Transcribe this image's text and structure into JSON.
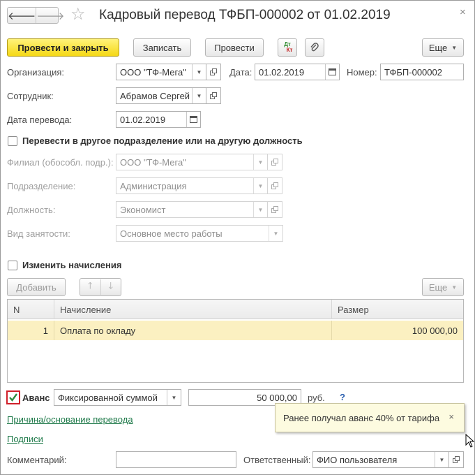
{
  "window": {
    "title": "Кадровый перевод ТФБП-000002 от 01.02.2019",
    "nav_back": "🡐",
    "nav_forward": "🡒",
    "favorite_glyph": "☆",
    "close_glyph": "×"
  },
  "toolbar": {
    "post_close_label": "Провести и закрыть",
    "write_label": "Записать",
    "post_label": "Провести",
    "dtkt_top": "Дт",
    "dtkt_bottom": "Кт",
    "more_label": "Еще"
  },
  "header": {
    "org_label": "Организация:",
    "org_value": "ООО \"ТФ-Мега\"",
    "date_label": "Дата:",
    "date_value": "01.02.2019",
    "number_label": "Номер:",
    "number_value": "ТФБП-000002",
    "employee_label": "Сотрудник:",
    "employee_value": "Абрамов Сергей",
    "transfer_date_label": "Дата перевода:",
    "transfer_date_value": "01.02.2019"
  },
  "transfer": {
    "checkbox_label": "Перевести в другое подразделение или на другую должность",
    "checked": false,
    "branch_label": "Филиал (обособл. подр.):",
    "branch_value": "ООО \"ТФ-Мега\"",
    "department_label": "Подразделение:",
    "department_value": "Администрация",
    "position_label": "Должность:",
    "position_value": "Экономист",
    "employment_label": "Вид занятости:",
    "employment_value": "Основное место работы"
  },
  "accruals": {
    "checkbox_label": "Изменить начисления",
    "checked": false,
    "add_label": "Добавить",
    "more_label": "Еще",
    "columns": {
      "n": "N",
      "accrual": "Начисление",
      "amount": "Размер"
    },
    "rows": [
      {
        "n": "1",
        "accrual": "Оплата по окладу",
        "amount": "100 000,00"
      }
    ]
  },
  "advance": {
    "label": "Аванс",
    "checked": true,
    "mode_value": "Фиксированной суммой",
    "amount_value": "50 000,00",
    "currency": "руб.",
    "help": "?"
  },
  "tooltip": {
    "text": "Ранее получал аванс 40% от тарифа",
    "close": "×"
  },
  "links": {
    "reason": "Причина/основание перевода",
    "signatures": "Подписи"
  },
  "footer": {
    "comment_label": "Комментарий:",
    "comment_value": "",
    "responsible_label": "Ответственный:",
    "responsible_value": "ФИО пользователя"
  },
  "colors": {
    "primary_button": "#f5d816",
    "selected_row": "#fbf0c1",
    "link": "#1f7a4a",
    "check_mark": "#2e8b3f",
    "checkbox_highlight": "#d0202a"
  }
}
